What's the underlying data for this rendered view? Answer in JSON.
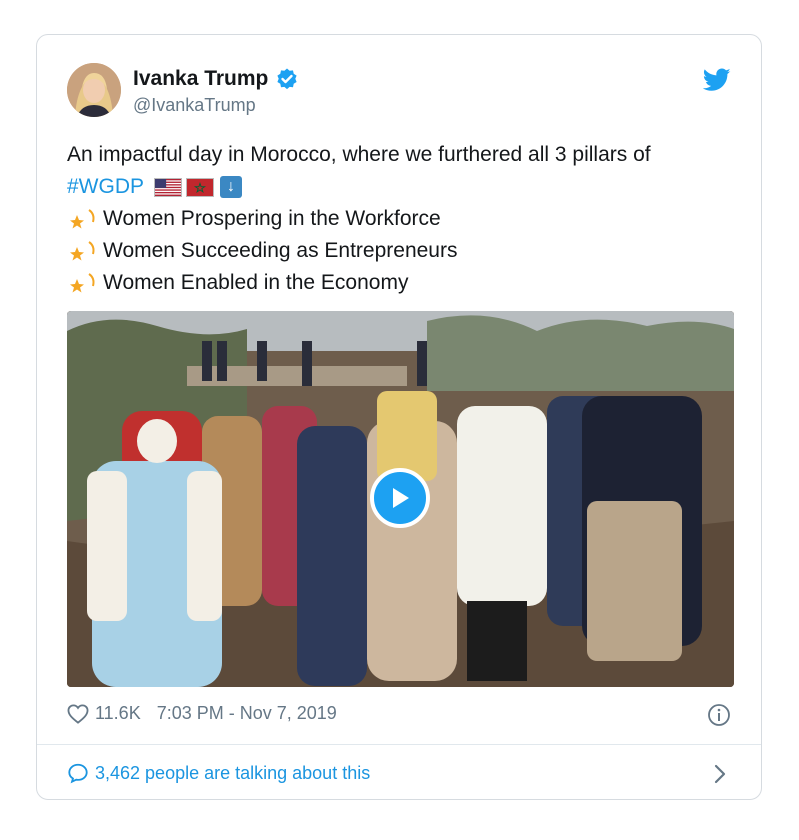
{
  "tweet": {
    "display_name": "Ivanka Trump",
    "handle": "@IvankaTrump",
    "text_line1": "An impactful day in Morocco, where we furthered all 3 pillars of",
    "hashtag": "#WGDP",
    "bullets": [
      "Women Prospering in the Workforce",
      "Women Succeeding as Entrepreneurs",
      "Women Enabled in the Economy"
    ],
    "icons": {
      "avatar": "profile-photo",
      "verified": "verified-badge-icon",
      "logo": "twitter-bird-icon",
      "flags": [
        "us-flag-icon",
        "morocco-flag-icon",
        "down-arrow-icon"
      ],
      "bullet": "dizzy-star-icon",
      "play": "play-icon",
      "like": "heart-icon",
      "info": "info-icon",
      "reply": "comment-icon",
      "chevron": "chevron-right-icon"
    }
  },
  "meta": {
    "like_count": "11.6K",
    "timestamp": "7:03 PM - Nov 7, 2019"
  },
  "footer": {
    "talking": "3,462 people are talking about this"
  },
  "colors": {
    "link": "#1b95e0",
    "text": "#14171a",
    "muted": "#657786",
    "border": "#d6dbe0",
    "play": "#1da1f2"
  }
}
